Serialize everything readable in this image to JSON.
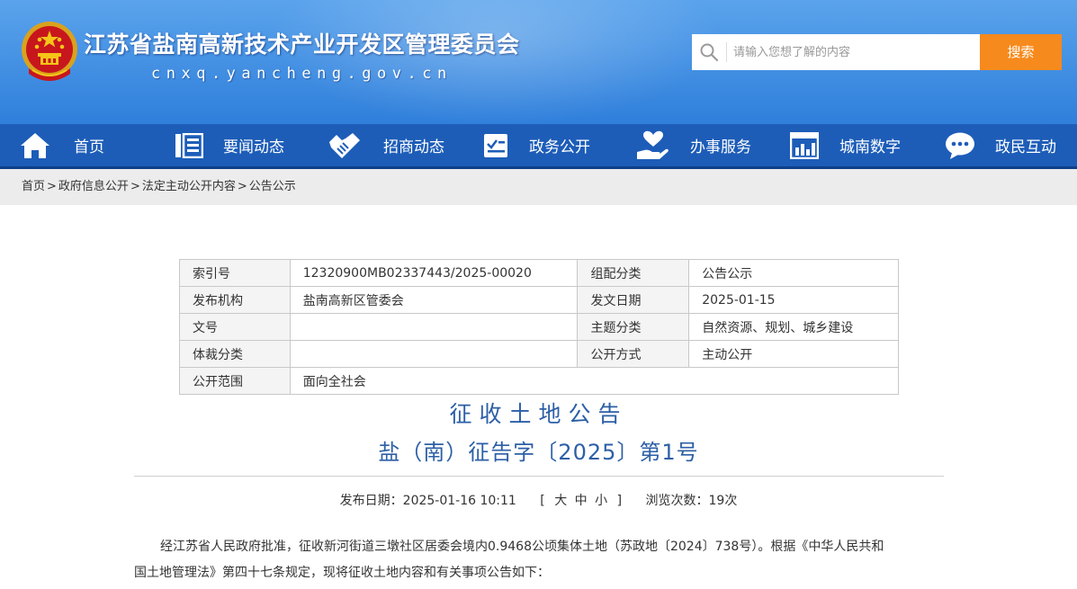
{
  "header": {
    "site_title": "江苏省盐南高新技术产业开发区管理委员会",
    "site_domain": "cnxq.yancheng.gov.cn",
    "emblem_icon": "national-emblem-icon",
    "search_placeholder": "请输入您想了解的内容",
    "search_button": "搜索",
    "search_button_color": "#f78a1d"
  },
  "nav": {
    "color": "#1d5db8",
    "items": [
      {
        "label": "首页",
        "icon": "home-icon"
      },
      {
        "label": "要闻动态",
        "icon": "news-icon"
      },
      {
        "label": "招商动态",
        "icon": "handshake-icon"
      },
      {
        "label": "政务公开",
        "icon": "doc-check-icon"
      },
      {
        "label": "办事服务",
        "icon": "hand-heart-icon"
      },
      {
        "label": "城南数字",
        "icon": "digital-screen-icon"
      },
      {
        "label": "政民互动",
        "icon": "chat-icon"
      }
    ]
  },
  "breadcrumb": [
    "首页",
    "政府信息公开",
    "法定主动公开内容",
    "公告公示"
  ],
  "breadcrumb_separator": ">",
  "meta": {
    "rows": [
      {
        "k1": "索引号",
        "v1": "12320900MB02337443/2025-00020",
        "k2": "组配分类",
        "v2": "公告公示"
      },
      {
        "k1": "发布机构",
        "v1": "盐南高新区管委会",
        "k2": "发文日期",
        "v2": "2025-01-15"
      },
      {
        "k1": "文号",
        "v1": "",
        "k2": "主题分类",
        "v2": "自然资源、规划、城乡建设"
      },
      {
        "k1": "体裁分类",
        "v1": "",
        "k2": "公开方式",
        "v2": "主动公开"
      },
      {
        "k1": "公开范围",
        "v1": "面向全社会"
      }
    ]
  },
  "article": {
    "title": "征收土地公告",
    "subtitle": "盐（南）征告字〔2025〕第1号",
    "publish_label": "发布日期：2025-01-16 10:11",
    "size_open": "[",
    "size_large": "大",
    "size_medium": "中",
    "size_small": "小",
    "size_close": "]",
    "views_label": "浏览次数：19次",
    "para_line1": "经江苏省人民政府批准，征收新河街道三墩社区居委会境内0.9468公顷集体土地（苏政地〔2024〕738号）。根据《中华人民共和",
    "para_line2": "国土地管理法》第四十七条规定，现将征收土地内容和有关事项公告如下：",
    "title_color": "#2c5fa6"
  }
}
